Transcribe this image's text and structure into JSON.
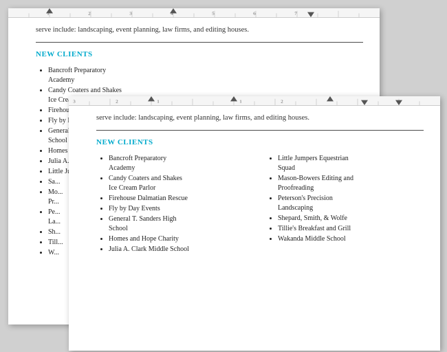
{
  "colors": {
    "accent": "#00aacc",
    "text": "#222222",
    "ruler_bg": "#f5f5f5"
  },
  "back_doc": {
    "intro": "serve include: landscaping, event planning, law firms, and editing houses.",
    "section_title": "NEW CLIENTS",
    "clients": [
      {
        "line1": "Bancroft Preparatory",
        "line2": "Academy"
      },
      {
        "line1": "Candy Coaters and Shakes",
        "line2": "Ice Cream Parlor"
      },
      {
        "line1": "Firehouse Dalmatian Rescue"
      },
      {
        "line1": "Fly by Day Events"
      },
      {
        "line1": "General T. Sanders High",
        "line2": "School"
      },
      {
        "line1": "Homes and Hope Charity"
      },
      {
        "line1": "Julia A. Clark Middle School"
      },
      {
        "line1": "Little Jumpers Equestrian"
      },
      {
        "line1": "Sa..."
      },
      {
        "line1": "Mo...",
        "line2": "Pr..."
      },
      {
        "line1": "Pe...",
        "line2": "La..."
      },
      {
        "line1": "Sh..."
      },
      {
        "line1": "Till..."
      },
      {
        "line1": "W..."
      }
    ]
  },
  "front_doc": {
    "intro": "serve include: landscaping, event planning, law firms, and editing houses.",
    "section_title": "NEW CLIENTS",
    "clients_left": [
      {
        "line1": "Bancroft Preparatory",
        "line2": "Academy"
      },
      {
        "line1": "Candy Coaters and Shakes",
        "line2": "Ice Cream Parlor"
      },
      {
        "line1": "Firehouse Dalmatian Rescue"
      },
      {
        "line1": "Fly by Day Events"
      },
      {
        "line1": "General T. Sanders High",
        "line2": "School"
      },
      {
        "line1": "Homes and Hope Charity"
      },
      {
        "line1": "Julia A. Clark Middle School"
      }
    ],
    "clients_right": [
      {
        "line1": "Little Jumpers Equestrian",
        "line2": "Squad"
      },
      {
        "line1": "Mason-Bowers Editing and",
        "line2": "Proofreading"
      },
      {
        "line1": "Peterson's Precision",
        "line2": "Landscaping"
      },
      {
        "line1": "Shepard, Smith, & Wolfe"
      },
      {
        "line1": "Tillie's Breakfast and Grill"
      },
      {
        "line1": "Wakanda Middle School"
      }
    ]
  }
}
